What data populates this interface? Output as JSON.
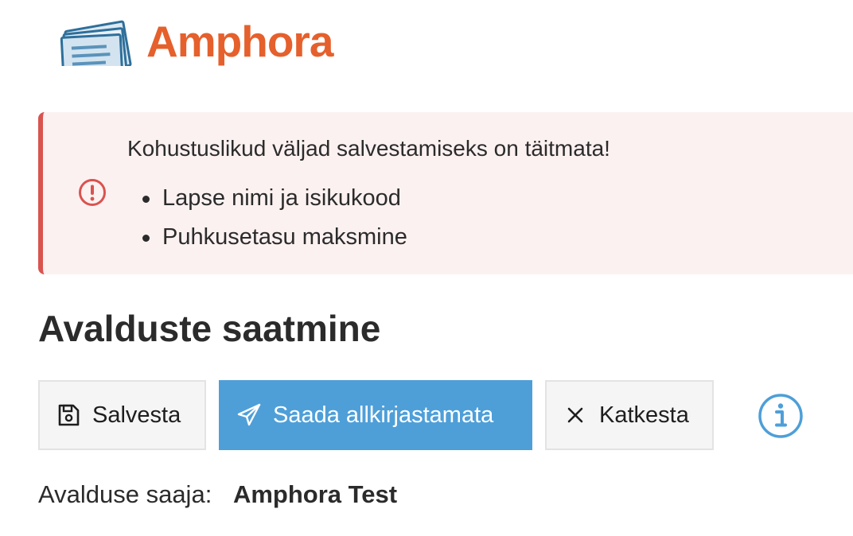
{
  "brand": {
    "name": "Amphora",
    "color": "#e5602c",
    "logo_icon": "stacked-documents-icon"
  },
  "alert": {
    "type": "error",
    "icon": "exclamation-circle-icon",
    "color": "#d9534f",
    "title": "Kohustuslikud väljad salvestamiseks on täitmata!",
    "items": [
      "Lapse nimi ja isikukood",
      "Puhkusetasu maksmine"
    ]
  },
  "page": {
    "title": "Avalduste saatmine"
  },
  "toolbar": {
    "save_label": "Salvesta",
    "save_icon": "floppy-disk-icon",
    "send_label": "Saada allkirjastamata",
    "send_icon": "paper-plane-icon",
    "send_color": "#4e9fd8",
    "cancel_label": "Katkesta",
    "cancel_icon": "close-icon",
    "info_icon": "info-circle-icon"
  },
  "recipient": {
    "label": "Avalduse saaja:",
    "value": "Amphora Test"
  }
}
